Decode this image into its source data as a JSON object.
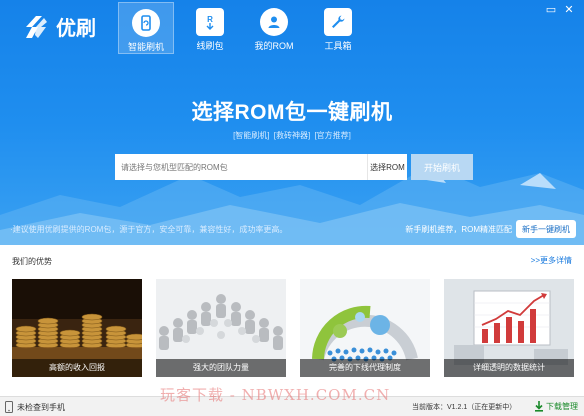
{
  "app": {
    "name": "优刷"
  },
  "nav": [
    {
      "label": "智能刷机",
      "icon": "phone-refresh-icon"
    },
    {
      "label": "线刷包",
      "icon": "rom-package-icon"
    },
    {
      "label": "我的ROM",
      "icon": "user-icon"
    },
    {
      "label": "工具箱",
      "icon": "wrench-icon"
    }
  ],
  "window_controls": {
    "minimize": "▭",
    "close": "✕"
  },
  "hero": {
    "headline": "选择ROM包一键刷机",
    "tags": [
      "[智能刷机]",
      "[救砖神器]",
      "[官方推荐]"
    ],
    "search_placeholder": "请选择与您机型匹配的ROM包",
    "select_label": "选择ROM",
    "flash_label": "开始刷机",
    "tip_left": "·建议使用优刷提供的ROM包，源于官方，安全可靠，兼容性好，成功率更高。",
    "tip_right": "新手刷机推荐，ROM精准匹配",
    "newbie_button": "新手一键刷机"
  },
  "advantages": {
    "title": "我们的优势",
    "more_label": ">>更多详情",
    "cards": [
      {
        "caption": "高额的收入回报"
      },
      {
        "caption": "强大的团队力量"
      },
      {
        "caption": "完善的下线代理制度"
      },
      {
        "caption": "详细透明的数据统计"
      }
    ]
  },
  "status": {
    "phone": "未检查到手机",
    "version": "当前版本：V1.2.1（正在更新中）",
    "download_manager": "下载管理"
  },
  "watermark": "玩客下载 - NBWXH.COM.CN",
  "colors": {
    "primary": "#1f8eef",
    "accent_link": "#1477dd",
    "download_green": "#1a8a2a"
  }
}
